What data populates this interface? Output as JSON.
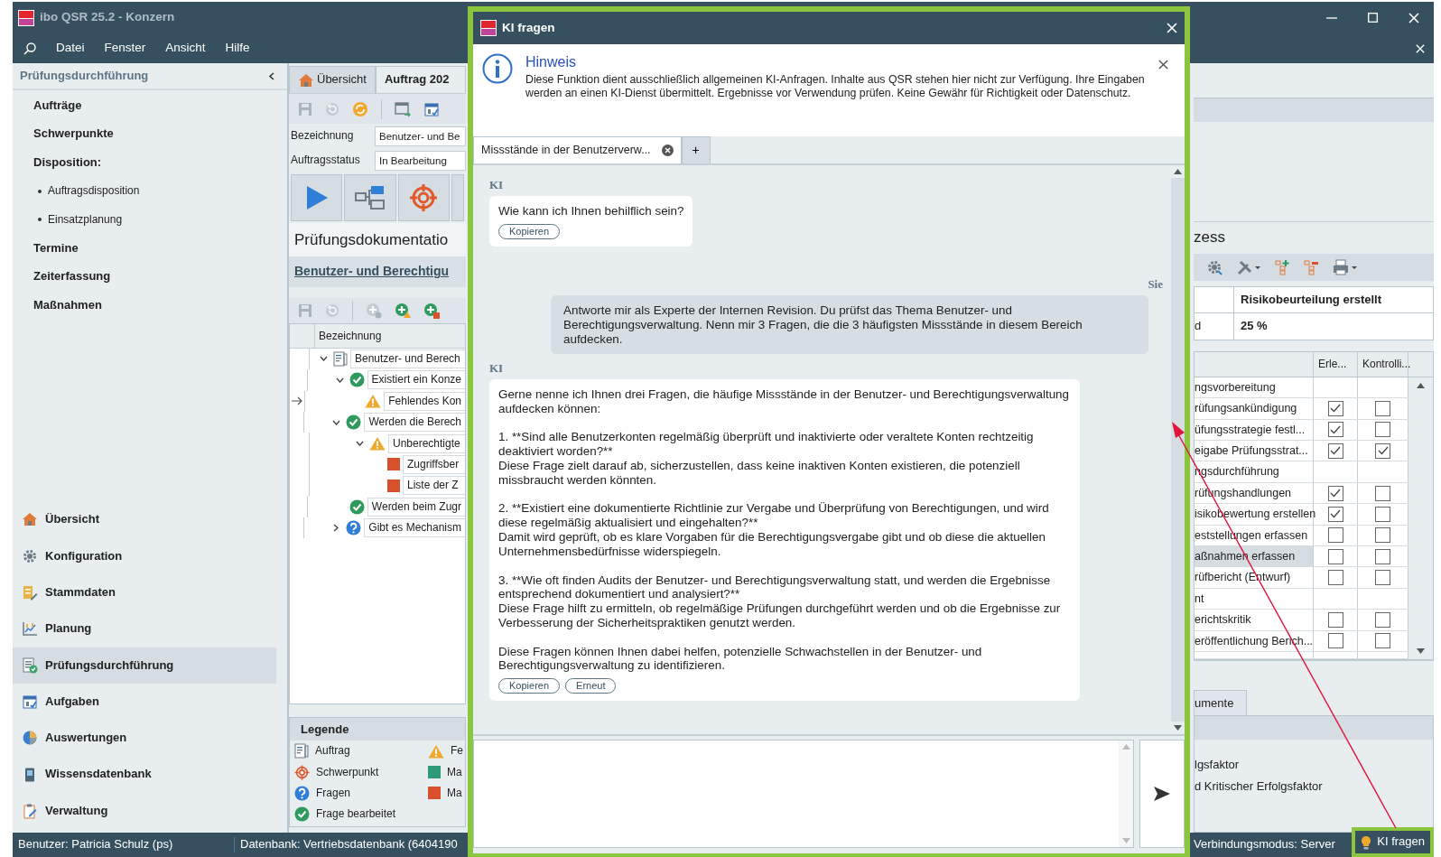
{
  "window": {
    "title": "ibo QSR 25.2 - Konzern"
  },
  "menu": [
    "Datei",
    "Fenster",
    "Ansicht",
    "Hilfe"
  ],
  "sidebar": {
    "title": "Prüfungsdurchführung",
    "items": [
      {
        "label": "Aufträge",
        "kind": "section"
      },
      {
        "label": "Schwerpunkte",
        "kind": "section"
      },
      {
        "label": "Disposition:",
        "kind": "section"
      },
      {
        "label": "Auftragsdisposition",
        "kind": "bullet"
      },
      {
        "label": "Einsatzplanung",
        "kind": "bullet"
      },
      {
        "label": "Termine",
        "kind": "section"
      },
      {
        "label": "Zeiterfassung",
        "kind": "section"
      },
      {
        "label": "Maßnahmen",
        "kind": "section"
      }
    ],
    "modules": [
      {
        "label": "Übersicht",
        "selected": false
      },
      {
        "label": "Konfiguration",
        "selected": false
      },
      {
        "label": "Stammdaten",
        "selected": false
      },
      {
        "label": "Planung",
        "selected": false
      },
      {
        "label": "Prüfungsdurchführung",
        "selected": true
      },
      {
        "label": "Aufgaben",
        "selected": false
      },
      {
        "label": "Auswertungen",
        "selected": false
      },
      {
        "label": "Wissensdatenbank",
        "selected": false
      },
      {
        "label": "Verwaltung",
        "selected": false
      }
    ]
  },
  "order": {
    "tabs": [
      {
        "label": "Übersicht",
        "selected": false
      },
      {
        "label": "Auftrag 202",
        "selected": true
      }
    ],
    "fields": [
      {
        "label": "Bezeichnung",
        "value": "Benutzer- und Be"
      },
      {
        "label": "Auftragsstatus",
        "value": "In Bearbeitung"
      }
    ],
    "documentation": {
      "title": "Prüfungsdokumentatio",
      "link": "Benutzer- und Berechtigu",
      "column": "Bezeichnung",
      "tree": [
        {
          "label": "Benutzer- und Berech",
          "kind": "order",
          "current": false,
          "expanded": true,
          "children": [
            {
              "label": "Existiert ein Konze",
              "kind": "done",
              "current": false,
              "expanded": true,
              "children": [
                {
                  "label": "Fehlendes Kon",
                  "kind": "finding",
                  "current": true
                }
              ]
            },
            {
              "label": "Werden die Berech",
              "kind": "done",
              "current": false,
              "expanded": true,
              "children": [
                {
                  "label": "Unberechtigte",
                  "kind": "finding",
                  "current": false,
                  "expanded": true,
                  "children": [
                    {
                      "label": "Zugriffsber",
                      "kind": "measure",
                      "current": false
                    },
                    {
                      "label": "Liste der Z",
                      "kind": "measure",
                      "current": false
                    }
                  ]
                }
              ]
            },
            {
              "label": "Werden beim Zugr",
              "kind": "done",
              "current": false
            },
            {
              "label": "Gibt es Mechanism",
              "kind": "question",
              "current": false,
              "expanded": false
            }
          ]
        }
      ]
    },
    "legend": {
      "title": "Legende",
      "items": [
        {
          "label": "Auftrag",
          "kind": "order"
        },
        {
          "label": "Schwerpunkt",
          "kind": "focus"
        },
        {
          "label": "Fragen",
          "kind": "question"
        },
        {
          "label": "Frage bearbeitet",
          "kind": "done"
        },
        {
          "label": "Fe",
          "kind": "finding"
        },
        {
          "label": "Ma",
          "kind": "measure-done"
        },
        {
          "label": "Ma",
          "kind": "measure"
        }
      ]
    }
  },
  "process": {
    "title": "zess",
    "info": [
      {
        "value": "Risikobeurteilung erstellt"
      },
      {
        "label": "d",
        "value": "25 %"
      }
    ],
    "columns": [
      "Erle...",
      "Kontrolli..."
    ],
    "rows": [
      {
        "label": "ngsvorbereitung",
        "kind": "group",
        "selected": false
      },
      {
        "label": "rüfungsankündigung",
        "kind": "task",
        "selected": false,
        "done": true,
        "controlled": false
      },
      {
        "label": "üfungsstrategie festl...",
        "kind": "task",
        "selected": false,
        "done": true,
        "controlled": false
      },
      {
        "label": "eigabe Prüfungsstrat...",
        "kind": "task",
        "selected": false,
        "done": true,
        "controlled": true
      },
      {
        "label": "ngsdurchführung",
        "kind": "group",
        "selected": false
      },
      {
        "label": "rüfungshandlungen",
        "kind": "task",
        "selected": false,
        "done": true,
        "controlled": false
      },
      {
        "label": "isikobewertung erstellen",
        "kind": "task",
        "selected": false,
        "done": true,
        "controlled": false
      },
      {
        "label": "eststellungen erfassen",
        "kind": "task",
        "selected": false,
        "done": false,
        "controlled": false
      },
      {
        "label": "aßnahmen erfassen",
        "kind": "task",
        "selected": true,
        "done": false,
        "controlled": false
      },
      {
        "label": "rüfbericht (Entwurf)",
        "kind": "task",
        "selected": false,
        "done": false,
        "controlled": false
      },
      {
        "label": "nt",
        "kind": "group",
        "selected": false
      },
      {
        "label": "erichtskritik",
        "kind": "task",
        "selected": false,
        "done": false,
        "controlled": false
      },
      {
        "label": "eröffentlichung Berich...",
        "kind": "task",
        "selected": false,
        "done": false,
        "controlled": false
      }
    ],
    "bottom_tab": "umente",
    "factors": [
      "lgsfaktor",
      "d Kritischer Erfolgsfaktor"
    ]
  },
  "status_bar": {
    "items": [
      "Benutzer: Patricia Schulz (ps)",
      "Datenbank: Vertriebsdatenbank (6404190",
      "Verbindungsmodus: Server"
    ],
    "ki_button": {
      "label": "KI fragen",
      "highlighted": true
    }
  },
  "dialog": {
    "title": "KI fragen",
    "highlighted": true,
    "notice": {
      "title": "Hinweis",
      "text": "Diese Funktion dient ausschließlich allgemeinen KI-Anfragen. Inhalte aus QSR stehen hier nicht zur Verfügung. Ihre Eingaben werden an einen KI-Dienst übermittelt. Ergebnisse vor Verwendung prüfen. Keine Gewähr für Richtigkeit oder Datenschutz."
    },
    "tabs": [
      {
        "label": "Missstände in der Benutzerverw...",
        "selected": true
      }
    ],
    "new_tab": "+",
    "messages": [
      {
        "sender": "KI",
        "kind": "ki",
        "text": "Wie kann ich Ihnen behilflich sein?",
        "actions": [
          "Kopieren"
        ]
      },
      {
        "sender": "Sie",
        "kind": "user",
        "text": "Antworte mir als Experte der Internen Revision. Du prüfst das Thema Benutzer- und Berechtigungsverwaltung. Nenn mir 3 Fragen, die die 3 häufigsten Missstände in diesem Bereich aufdecken."
      },
      {
        "sender": "KI",
        "kind": "ki",
        "text": "Gerne nenne ich Ihnen drei Fragen, die häufige Missstände in der Benutzer- und Berechtigungsverwaltung aufdecken können:\n\n1. **Sind alle Benutzerkonten regelmäßig überprüft und inaktivierte oder veraltete Konten rechtzeitig deaktiviert worden?**\nDiese Frage zielt darauf ab, sicherzustellen, dass keine inaktiven Konten existieren, die potenziell missbraucht werden könnten.\n\n2. **Existiert eine dokumentierte Richtlinie zur Vergabe und Überprüfung von Berechtigungen, und wird diese regelmäßig aktualisiert und eingehalten?**\nDamit wird geprüft, ob es klare Vorgaben für die Berechtigungsvergabe gibt und ob diese die aktuellen Unternehmensbedürfnisse widerspiegeln.\n\n3. **Wie oft finden Audits der Benutzer- und Berechtigungsverwaltung statt, und werden die Ergebnisse entsprechend dokumentiert und analysiert?**\nDiese Frage hilft zu ermitteln, ob regelmäßige Prüfungen durchgeführt werden und ob die Ergebnisse zur Verbesserung der Sicherheitspraktiken genutzt werden.\n\nDiese Fragen können Ihnen dabei helfen, potenzielle Schwachstellen in der Benutzer- und Berechtigungsverwaltung zu identifizieren.",
        "actions": [
          "Kopieren",
          "Erneut"
        ]
      }
    ]
  },
  "annotation_arrow": true
}
